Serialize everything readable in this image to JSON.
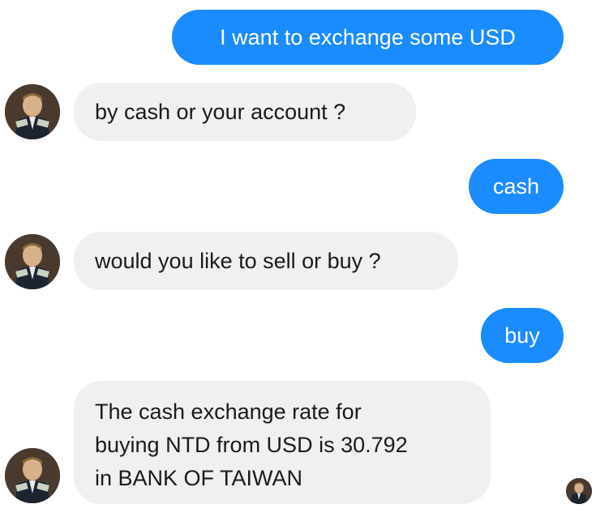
{
  "messages": [
    {
      "sender": "user",
      "text": "I want to exchange some USD"
    },
    {
      "sender": "bot",
      "text": "by cash or your account ?"
    },
    {
      "sender": "user",
      "text": "cash"
    },
    {
      "sender": "bot",
      "text": "would you like to sell or buy ?"
    },
    {
      "sender": "user",
      "text": "buy"
    },
    {
      "sender": "bot",
      "text": "The cash exchange rate for\nbuying NTD from USD is 30.792\nin BANK OF TAIWAN"
    }
  ],
  "colors": {
    "user_bubble": "#1a8cff",
    "user_text": "#ffffff",
    "bot_bubble": "#f0f0f0",
    "bot_text": "#1a1a1a"
  },
  "icons": {
    "bot_avatar": "bot-avatar-icon",
    "read_receipt": "read-receipt-avatar-icon"
  }
}
